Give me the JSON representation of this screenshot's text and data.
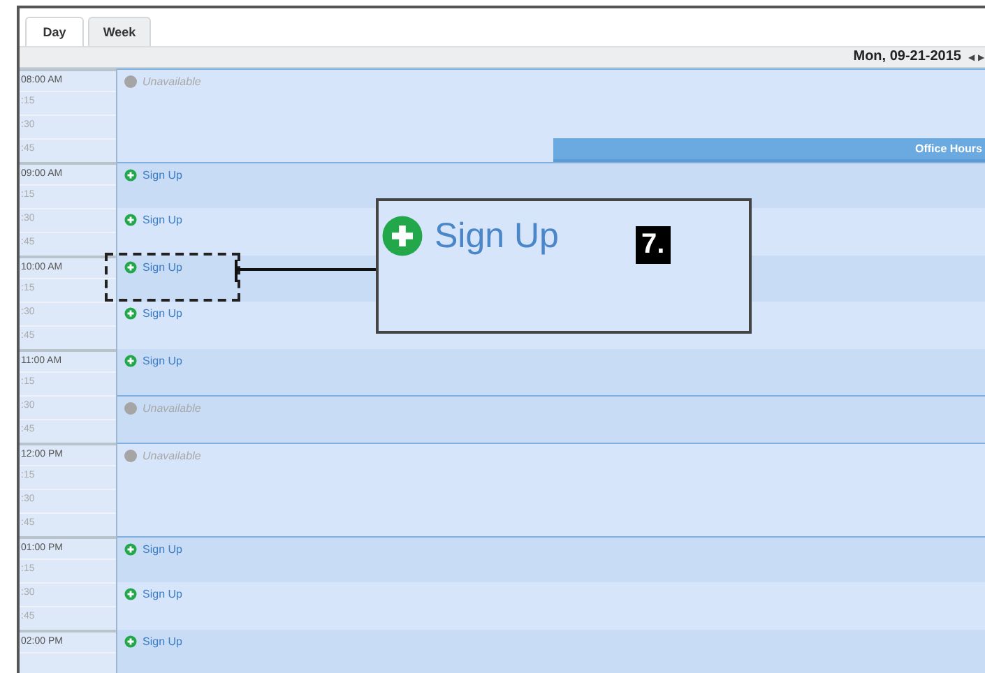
{
  "tabs": [
    {
      "label": "Day",
      "selected": true
    },
    {
      "label": "Week",
      "selected": false
    }
  ],
  "header": {
    "date": "Mon, 09-21-2015",
    "prev": "◀",
    "next": "▶"
  },
  "hours": [
    {
      "label": "08:00 AM",
      "quarters": [
        ":15",
        ":30",
        ":45"
      ]
    },
    {
      "label": "09:00 AM",
      "quarters": [
        ":15",
        ":30",
        ":45"
      ]
    },
    {
      "label": "10:00 AM",
      "quarters": [
        ":15",
        ":30",
        ":45"
      ]
    },
    {
      "label": "11:00 AM",
      "quarters": [
        ":15",
        ":30",
        ":45"
      ]
    },
    {
      "label": "12:00 PM",
      "quarters": [
        ":15",
        ":30",
        ":45"
      ]
    },
    {
      "label": "01:00 PM",
      "quarters": [
        ":15",
        ":30",
        ":45"
      ]
    },
    {
      "label": "02:00 PM"
    }
  ],
  "events": [
    {
      "kind": "unavailable",
      "label": "Unavailable",
      "full_hour": true,
      "banner": "Office Hours"
    },
    {
      "kind": "signup",
      "label": "Sign Up",
      "full_hour": false
    },
    {
      "kind": "signup",
      "label": "Sign Up",
      "full_hour": false
    },
    {
      "kind": "signup",
      "label": "Sign Up",
      "full_hour": false
    },
    {
      "kind": "signup",
      "label": "Sign Up",
      "full_hour": false
    },
    {
      "kind": "signup",
      "label": "Sign Up",
      "full_hour": false
    },
    {
      "kind": "unavailable",
      "label": "Unavailable",
      "full_hour": false
    },
    {
      "kind": "unavailable",
      "label": "Unavailable",
      "full_hour": true
    },
    {
      "kind": "signup",
      "label": "Sign Up",
      "full_hour": false
    },
    {
      "kind": "signup",
      "label": "Sign Up",
      "full_hour": false
    },
    {
      "kind": "signup",
      "label": "Sign Up",
      "full_hour": false
    }
  ],
  "callout": {
    "text": "Sign Up",
    "badge": "7."
  }
}
